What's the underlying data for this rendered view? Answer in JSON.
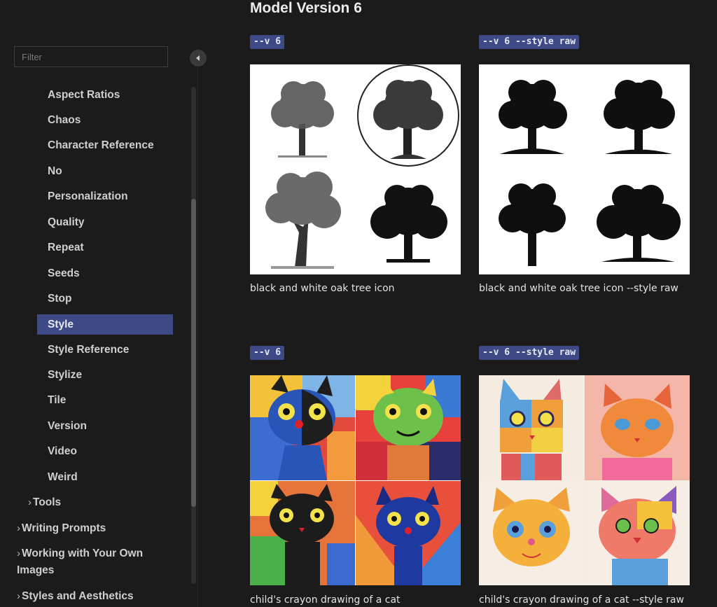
{
  "sidebar": {
    "filter_placeholder": "Filter",
    "items": [
      {
        "label": "Aspect Ratios"
      },
      {
        "label": "Chaos"
      },
      {
        "label": "Character Reference"
      },
      {
        "label": "No"
      },
      {
        "label": "Personalization"
      },
      {
        "label": "Quality"
      },
      {
        "label": "Repeat"
      },
      {
        "label": "Seeds"
      },
      {
        "label": "Stop"
      },
      {
        "label": "Style",
        "active": true
      },
      {
        "label": "Style Reference"
      },
      {
        "label": "Stylize"
      },
      {
        "label": "Tile"
      },
      {
        "label": "Version"
      },
      {
        "label": "Video"
      },
      {
        "label": "Weird"
      }
    ],
    "sections": [
      {
        "label": "Tools"
      },
      {
        "label": "Writing Prompts"
      },
      {
        "label": "Working with Your Own Images"
      },
      {
        "label": "Styles and Aesthetics"
      }
    ],
    "active_color": "#3d4a85"
  },
  "main": {
    "title": "Model Version 6",
    "examples": [
      {
        "tag": "--v 6",
        "caption": "black and white oak tree icon",
        "image": "four-oak-tree-drawings"
      },
      {
        "tag": "--v 6 --style raw",
        "caption": "black and white oak tree icon --style raw",
        "image": "four-oak-tree-silhouettes"
      },
      {
        "tag": "--v 6",
        "caption": "child's crayon drawing of a cat",
        "image": "four-crayon-cat-drawings"
      },
      {
        "tag": "--v 6 --style raw",
        "caption": "child's crayon drawing of a cat --style raw",
        "image": "four-crayon-cat-drawings-raw"
      }
    ]
  }
}
